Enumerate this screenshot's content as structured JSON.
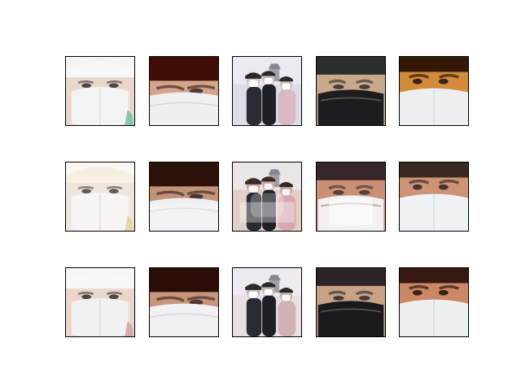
{
  "figure": {
    "rows": [
      {
        "tiles": [
          {
            "subject": "white-cap-white-mask",
            "skin": "#e9d7cc",
            "bg": "#f4f4f4",
            "hat": "#f7f7f7",
            "mask": "#f3f3f3",
            "accent": "#69bfa4"
          },
          {
            "subject": "closeup-red-bg-white-mask",
            "skin": "#d4a48a",
            "bg": "#6b1a10",
            "hat": "#3a0d07",
            "mask": "#f0f0f0",
            "accent": "#8a2a1a"
          },
          {
            "subject": "crowd-masked-street",
            "skin": "#cfc0bc",
            "bg": "#dcdde6",
            "hat": "#2a2a2a",
            "mask": "#ffffff",
            "accent": "#d9b8c3"
          },
          {
            "subject": "black-mask-face",
            "skin": "#c9a98c",
            "bg": "#3c3c3e",
            "hat": "#2b2b2b",
            "mask": "#1d1d1f",
            "accent": "#6b6b6b"
          },
          {
            "subject": "orange-skin-white-mask",
            "skin": "#d38a3a",
            "bg": "#8a4a1a",
            "hat": "#2a1408",
            "mask": "#eceff0",
            "accent": "#b36a2a"
          }
        ]
      },
      {
        "tiles": [
          {
            "subject": "white-cap-white-mask",
            "skin": "#ede3db",
            "bg": "#faf7f3",
            "hat": "#f5efdf",
            "mask": "#f7f4f2",
            "accent": "#e0c98c"
          },
          {
            "subject": "closeup-red-bg-white-mask",
            "skin": "#c39378",
            "bg": "#3a1a10",
            "hat": "#2a1108",
            "mask": "#eef0f2",
            "accent": "#7a3a2a"
          },
          {
            "subject": "crowd-masked-street",
            "skin": "#c7a99e",
            "bg": "#e2cfc6",
            "hat": "#3a2a2a",
            "mask": "#f6f3f4",
            "accent": "#d9a9b3"
          },
          {
            "subject": "black-mask-face",
            "skin": "#c8896e",
            "bg": "#3a2426",
            "hat": "#2b1a1c",
            "mask": "#f1f1f1",
            "accent": "#b27a6a"
          },
          {
            "subject": "orange-skin-white-mask",
            "skin": "#c98a6a",
            "bg": "#a03a2a",
            "hat": "#1e1410",
            "mask": "#eef1f3",
            "accent": "#7a4a2a"
          }
        ]
      },
      {
        "tiles": [
          {
            "subject": "white-cap-white-mask",
            "skin": "#ead7cc",
            "bg": "#f5f5f5",
            "hat": "#f7f7f7",
            "mask": "#f1f1f1",
            "accent": "#cf9e9e"
          },
          {
            "subject": "closeup-red-bg-white-mask",
            "skin": "#c9957a",
            "bg": "#4a1a10",
            "hat": "#2a0d07",
            "mask": "#eff1f3",
            "accent": "#8a2a1a"
          },
          {
            "subject": "crowd-masked-street",
            "skin": "#c5b4ad",
            "bg": "#e6e1e3",
            "hat": "#2a2a2a",
            "mask": "#ffffff",
            "accent": "#d2b0b6"
          },
          {
            "subject": "black-mask-face",
            "skin": "#c6a386",
            "bg": "#3a3032",
            "hat": "#2a2224",
            "mask": "#1a1a1c",
            "accent": "#6a6a6a"
          },
          {
            "subject": "orange-skin-white-mask",
            "skin": "#cc8863",
            "bg": "#a2412f",
            "hat": "#2a1610",
            "mask": "#edf0f2",
            "accent": "#b35a3a"
          }
        ]
      }
    ]
  }
}
